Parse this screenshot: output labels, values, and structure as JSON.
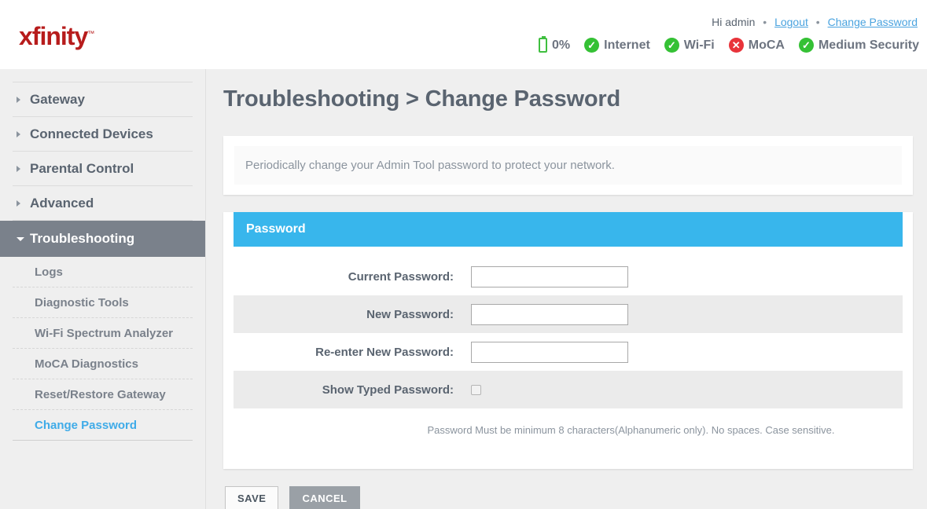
{
  "header": {
    "logo_text": "xfinity",
    "logo_tm": "™",
    "greeting": "Hi admin",
    "separator": "•",
    "logout_label": "Logout",
    "change_password_label": "Change Password",
    "status": [
      {
        "icon": "battery-icon",
        "label": "0%",
        "state": "battery"
      },
      {
        "icon": "check-circle-icon",
        "label": "Internet",
        "state": "ok"
      },
      {
        "icon": "check-circle-icon",
        "label": "Wi-Fi",
        "state": "ok"
      },
      {
        "icon": "error-circle-icon",
        "label": "MoCA",
        "state": "err"
      },
      {
        "icon": "check-circle-icon",
        "label": "Medium Security",
        "state": "ok"
      }
    ]
  },
  "sidebar": {
    "items": [
      {
        "label": "Gateway",
        "active": false
      },
      {
        "label": "Connected Devices",
        "active": false
      },
      {
        "label": "Parental Control",
        "active": false
      },
      {
        "label": "Advanced",
        "active": false
      },
      {
        "label": "Troubleshooting",
        "active": true
      }
    ],
    "subitems": [
      {
        "label": "Logs",
        "current": false
      },
      {
        "label": "Diagnostic Tools",
        "current": false
      },
      {
        "label": "Wi-Fi Spectrum Analyzer",
        "current": false
      },
      {
        "label": "MoCA Diagnostics",
        "current": false
      },
      {
        "label": "Reset/Restore Gateway",
        "current": false
      },
      {
        "label": "Change Password",
        "current": true
      }
    ]
  },
  "main": {
    "page_title": "Troubleshooting > Change Password",
    "intro_text": "Periodically change your Admin Tool password to protect your network.",
    "card_title": "Password",
    "fields": [
      {
        "label": "Current Password:",
        "value": "",
        "type": "password"
      },
      {
        "label": "New Password:",
        "value": "",
        "type": "password"
      },
      {
        "label": "Re-enter New Password:",
        "value": "",
        "type": "password"
      }
    ],
    "show_password_label": "Show Typed Password:",
    "show_password_checked": false,
    "hint": "Password Must be minimum 8 characters(Alphanumeric only). No spaces. Case sensitive.",
    "save_label": "SAVE",
    "cancel_label": "CANCEL"
  },
  "colors": {
    "brand_red": "#b71c1c",
    "accent_blue": "#38b6ec",
    "link_blue": "#4aa3df",
    "active_nav": "#7a818b",
    "ok_green": "#35c135",
    "err_red": "#e8333a"
  }
}
